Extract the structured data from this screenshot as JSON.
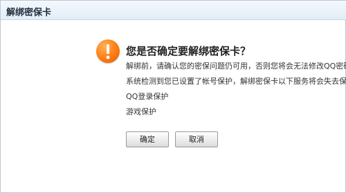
{
  "dialog": {
    "title": "解绑密保卡",
    "heading": "您是否确定要解绑密保卡？",
    "lines": [
      "解绑前，请确认您的密保问题仍可用，否则您将会无法修改QQ密码等",
      "系统检测到您已设置了帐号保护，解绑密保卡以下服务将会失去保护：",
      "QQ登录保护",
      "游戏保护"
    ],
    "confirm_label": "确定",
    "cancel_label": "取消"
  },
  "colors": {
    "accent_orange": "#ff7a12",
    "titlebar_bg": "#e3edf7"
  },
  "icons": {
    "warning": "exclamation-warning-icon"
  }
}
